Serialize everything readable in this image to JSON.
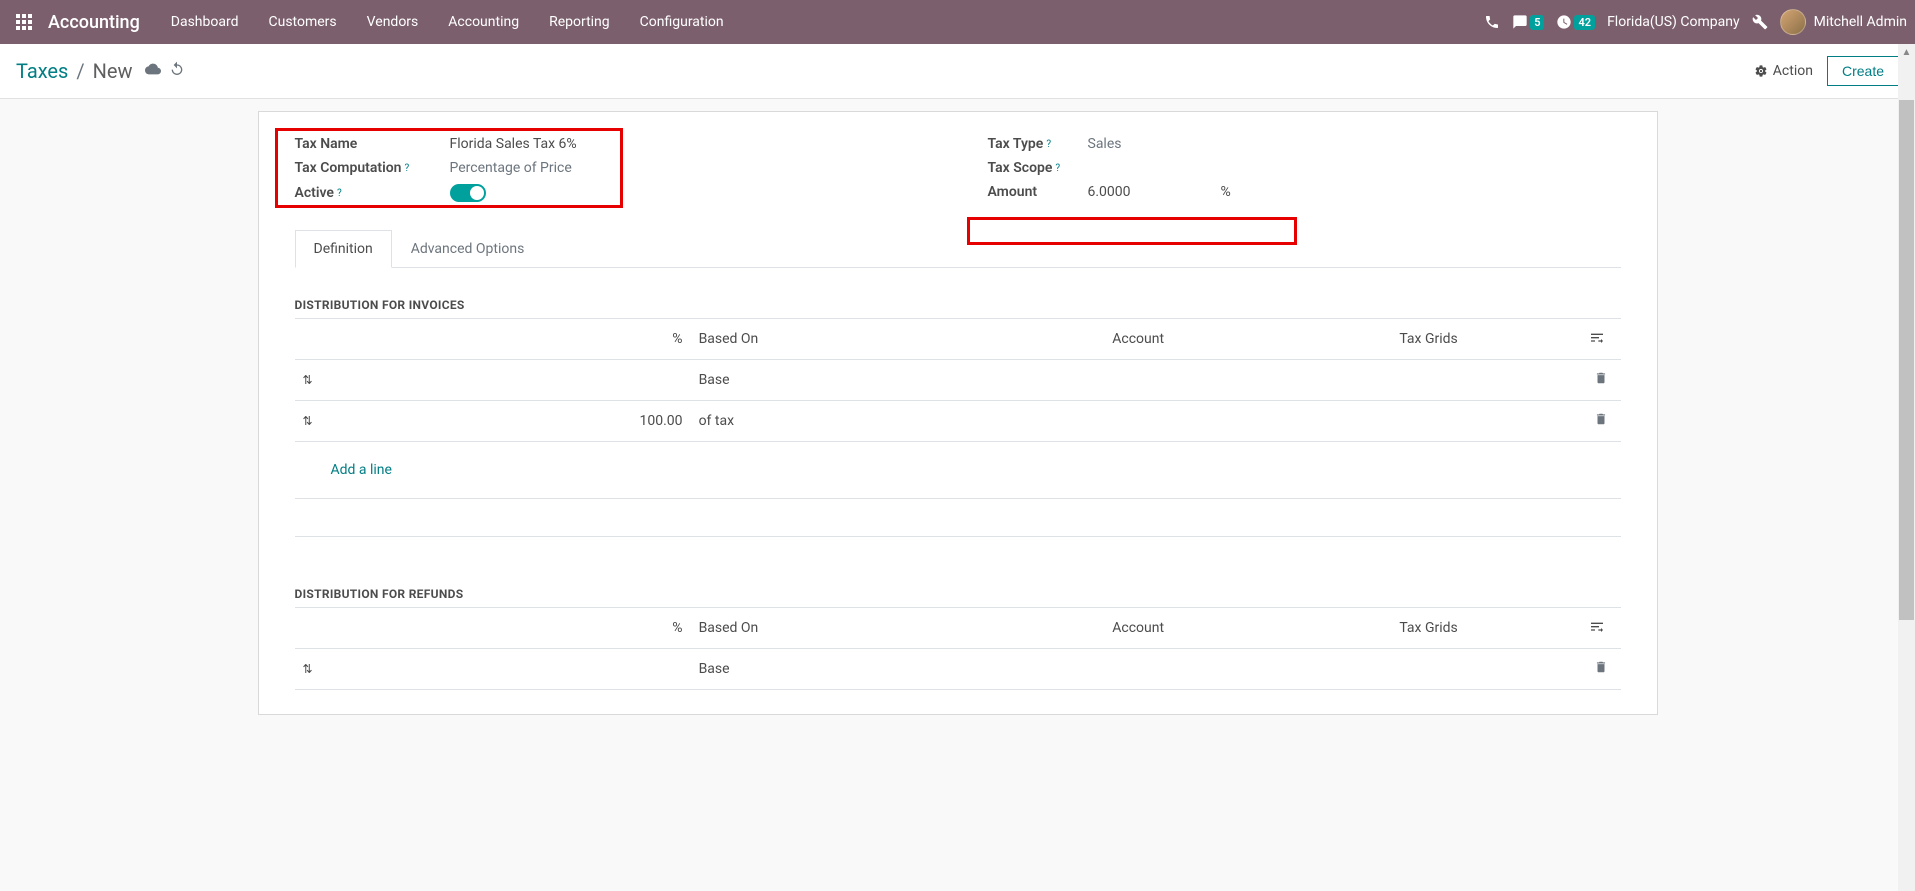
{
  "navbar": {
    "app": "Accounting",
    "menu": [
      "Dashboard",
      "Customers",
      "Vendors",
      "Accounting",
      "Reporting",
      "Configuration"
    ],
    "messages_badge": "5",
    "activities_badge": "42",
    "company": "Florida(US) Company",
    "user": "Mitchell Admin"
  },
  "breadcrumb": {
    "parent": "Taxes",
    "current": "New"
  },
  "controls": {
    "action": "Action",
    "create": "Create"
  },
  "form": {
    "tax_name_label": "Tax Name",
    "tax_name_value": "Florida Sales Tax 6%",
    "tax_computation_label": "Tax Computation",
    "tax_computation_value": "Percentage of Price",
    "active_label": "Active",
    "tax_type_label": "Tax Type",
    "tax_type_value": "Sales",
    "tax_scope_label": "Tax Scope",
    "amount_label": "Amount",
    "amount_value": "6.0000",
    "amount_suffix": "%"
  },
  "tabs": {
    "definition": "Definition",
    "advanced": "Advanced Options"
  },
  "sections": {
    "invoices_title": "DISTRIBUTION FOR INVOICES",
    "refunds_title": "DISTRIBUTION FOR REFUNDS",
    "headers": {
      "pct": "%",
      "based_on": "Based On",
      "account": "Account",
      "tax_grids": "Tax Grids"
    },
    "invoice_rows": [
      {
        "pct": "",
        "based_on": "Base"
      },
      {
        "pct": "100.00",
        "based_on": "of tax"
      }
    ],
    "refund_rows": [
      {
        "pct": "",
        "based_on": "Base"
      }
    ],
    "add_line": "Add a line"
  }
}
